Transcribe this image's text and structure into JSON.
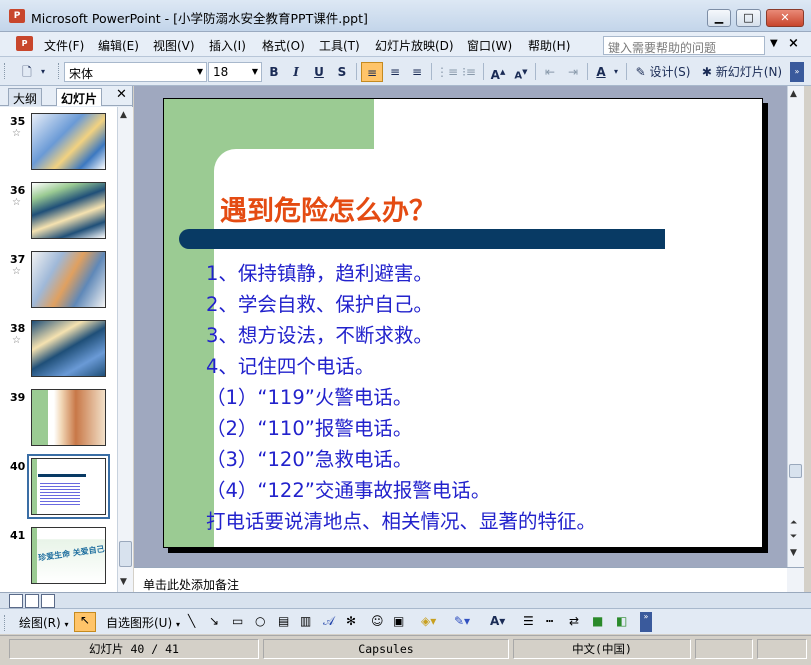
{
  "window": {
    "title": "Microsoft PowerPoint - [小学防溺水安全教育PPT课件.ppt]",
    "min_glyph": "▁",
    "max_glyph": "□",
    "close_glyph": "✕"
  },
  "menubar": {
    "items": [
      "文件(F)",
      "编辑(E)",
      "视图(V)",
      "插入(I)",
      "格式(O)",
      "工具(T)",
      "幻灯片放映(D)",
      "窗口(W)",
      "帮助(H)"
    ],
    "help_placeholder": "键入需要帮助的问题"
  },
  "toolbar": {
    "font": "宋体",
    "font_size": "18",
    "bold": "B",
    "italic": "I",
    "underline": "U",
    "shadow": "S",
    "design_label": "设计(S)",
    "new_slide_label": "新幻灯片(N)"
  },
  "leftpane": {
    "tab_outline": "大纲",
    "tab_slides": "幻灯片",
    "close": "✕",
    "thumbnails": [
      {
        "num": "35",
        "star": "☆"
      },
      {
        "num": "36",
        "star": "☆"
      },
      {
        "num": "37",
        "star": "☆"
      },
      {
        "num": "38",
        "star": "☆"
      },
      {
        "num": "39",
        "star": ""
      },
      {
        "num": "40",
        "star": "",
        "selected": true
      },
      {
        "num": "41",
        "star": "",
        "caption": "珍爱生命 关爱自己"
      }
    ]
  },
  "slide": {
    "title": "遇到危险怎么办？",
    "lines": [
      "1、保持镇静，趋利避害。",
      "2、学会自救、保护自己。",
      "3、想方设法，不断求救。",
      "4、记住四个电话。",
      "（1）“119”火警电话。",
      "（2）“110”报警电话。",
      "（3）“120”急救电话。",
      "（4）“122”交通事故报警电话。",
      "打电话要说清地点、相关情况、显著的特征。"
    ],
    "colors": {
      "title": "#e44b12",
      "body": "#2222cc",
      "bar": "#083a64",
      "green": "#9bcb93"
    }
  },
  "notes": {
    "placeholder": "单击此处添加备注"
  },
  "drawbar": {
    "draw_label": "绘图(R)",
    "autoshape_label": "自选图形(U)"
  },
  "status": {
    "slide_counter": "幻灯片 40 / 41",
    "theme": "Capsules",
    "language": "中文(中国)"
  }
}
